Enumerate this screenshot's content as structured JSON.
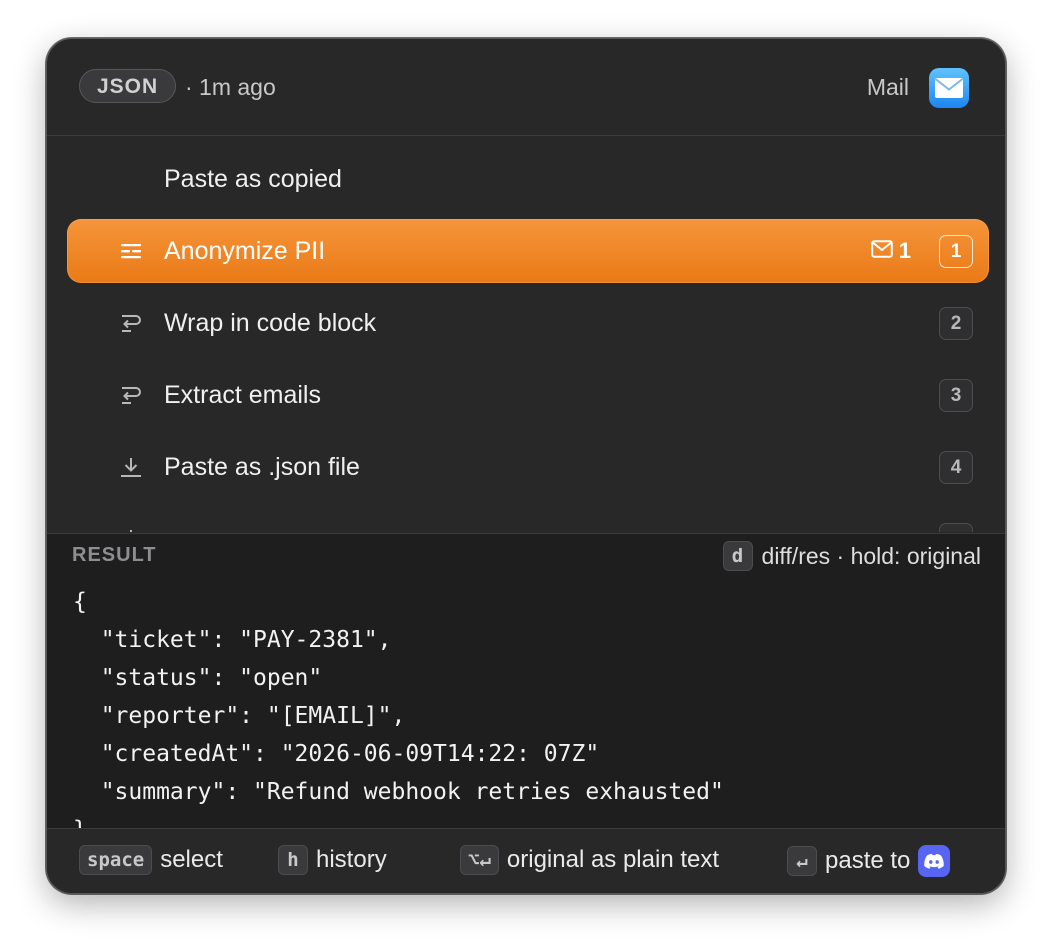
{
  "header": {
    "content_type": "JSON",
    "time_ago": "· 1m ago",
    "source_app": "Mail",
    "source_app_icon": "mail-app-icon"
  },
  "actions": [
    {
      "label": "Paste as copied",
      "icon": "none",
      "shortcut": ""
    },
    {
      "label": "Anonymize PII",
      "icon": "redact-icon",
      "shortcut": "1",
      "selected": true,
      "detected_count": "1",
      "detected_icon": "envelope-icon"
    },
    {
      "label": "Wrap in code block",
      "icon": "transform-icon",
      "shortcut": "2"
    },
    {
      "label": "Extract emails",
      "icon": "transform-icon",
      "shortcut": "3"
    },
    {
      "label": "Paste as .json file",
      "icon": "download-icon",
      "shortcut": "4"
    }
  ],
  "result": {
    "title": "RESULT",
    "diff_key": "d",
    "diff_hint": "diff/res · hold: original",
    "code_lines": [
      "{",
      "  \"ticket\": \"PAY-2381\",",
      "  \"status\": \"open\"",
      "  \"reporter\": \"[EMAIL]\",",
      "  \"createdAt\": \"2026-06-09T14:22: 07Z\"",
      "  \"summary\": \"Refund webhook retries exhausted\"",
      "}"
    ]
  },
  "footer": {
    "select_key": "space",
    "select_label": "select",
    "history_key": "h",
    "history_label": "history",
    "original_key": "⌥↵",
    "original_label": "original as plain text",
    "paste_key": "↵",
    "paste_label": "paste to",
    "paste_target_icon": "discord-icon"
  },
  "colors": {
    "accent": "#f0862a",
    "panel": "#282829",
    "result_bg": "#1e1e1f"
  }
}
